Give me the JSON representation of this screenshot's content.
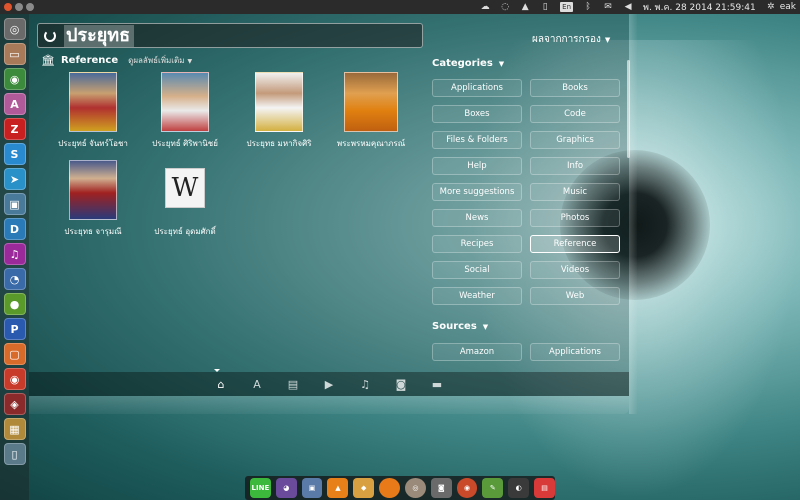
{
  "top_panel": {
    "keyboard_layout": "En",
    "clock": "พ. พ.ค. 28 2014 21:59:41",
    "user": "eak"
  },
  "search": {
    "query": "ประยุทธ"
  },
  "filter_results_label": "ผลจากการกรอง",
  "category": {
    "title": "Reference",
    "see_more": "ดูผลลัพธ์เพิ่มเติม"
  },
  "results": [
    {
      "label": "ประยุทธ์ จันทร์โอชา"
    },
    {
      "label": "ประยุทธ์ ศิริพานิชย์"
    },
    {
      "label": "ประยุทธ มหากิจศิริ"
    },
    {
      "label": "พระพรหมคุณาภรณ์"
    },
    {
      "label": "ประยุทธ จารุมณี"
    },
    {
      "label": "ประยุทธ์ อุดมศักดิ์"
    }
  ],
  "wiki_glyph": "W",
  "filters": {
    "categories_title": "Categories",
    "categories": [
      "Applications",
      "Books",
      "Boxes",
      "Code",
      "Files & Folders",
      "Graphics",
      "Help",
      "Info",
      "More suggestions",
      "Music",
      "News",
      "Photos",
      "Recipes",
      "Reference",
      "Social",
      "Videos",
      "Weather",
      "Web"
    ],
    "active_category": "Reference",
    "sources_title": "Sources",
    "sources": [
      "Amazon",
      "Applications"
    ]
  },
  "colors": {
    "accent": "#e0542e",
    "panel": "#2b2b2b"
  },
  "launcher_icons": [
    "dash-home-icon",
    "files-icon",
    "chrome-icon",
    "software-center-icon",
    "filezilla-icon",
    "skype-icon",
    "telegram-icon",
    "image-viewer-icon",
    "app-d-icon",
    "headphones-icon",
    "app-blue-icon",
    "app-green-icon",
    "app-p-icon",
    "app-orange-icon",
    "app-red-icon",
    "app-dark-red-icon",
    "app-photo-icon",
    "trash-icon"
  ],
  "lens_icons": [
    "home-lens-icon",
    "applications-lens-icon",
    "files-lens-icon",
    "video-lens-icon",
    "music-lens-icon",
    "photos-lens-icon",
    "social-lens-icon"
  ],
  "dock_icons": [
    "line-icon",
    "pidgin-icon",
    "screenshot-icon",
    "vlc-icon",
    "ibus-icon",
    "app-orange-ball-icon",
    "disc-icon",
    "camera-icon",
    "chrome-icon",
    "editor-icon",
    "system-monitor-icon",
    "app-red-icon"
  ]
}
